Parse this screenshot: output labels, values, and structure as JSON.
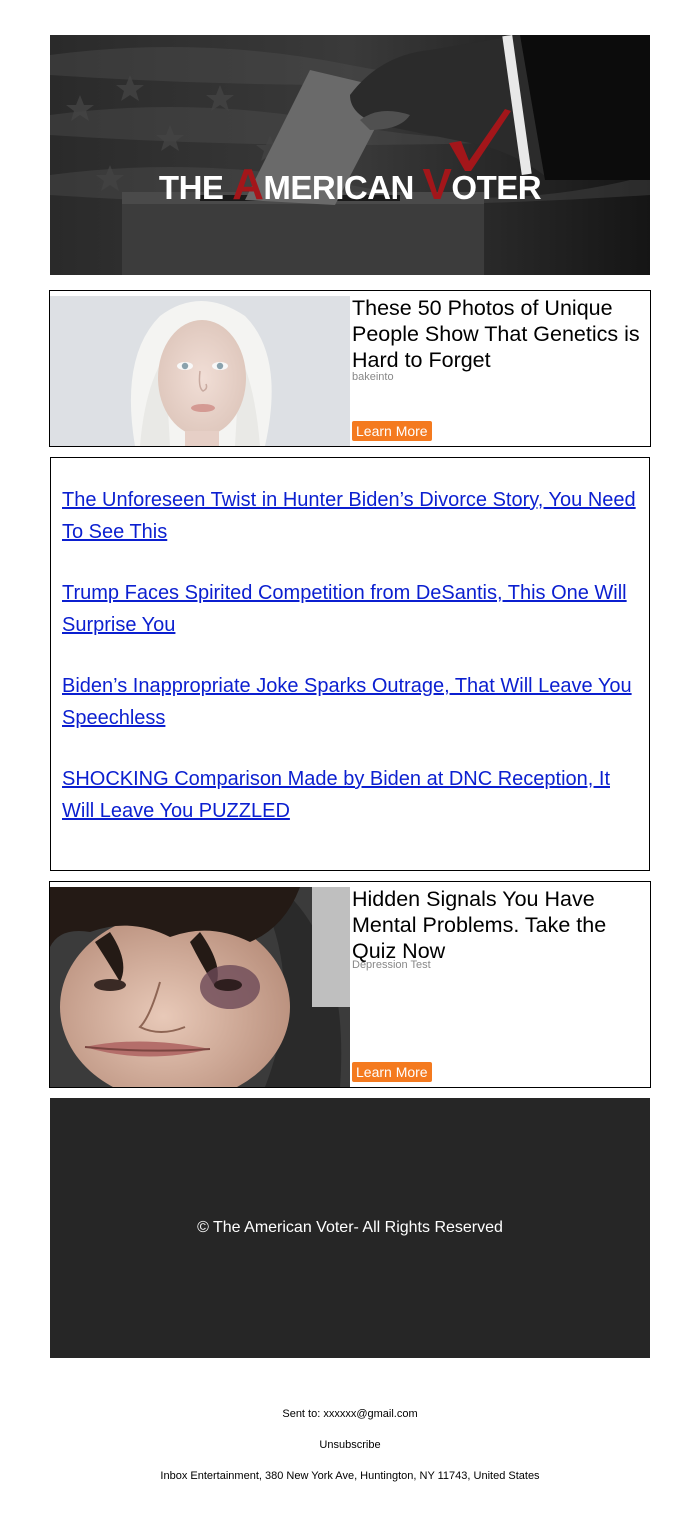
{
  "header": {
    "logo_part1": "THE ",
    "logo_cap_a": "A",
    "logo_part2": "MERICAN ",
    "logo_cap_v": "V",
    "logo_part3": "OTER"
  },
  "ads": [
    {
      "title": "These 50 Photos of Unique People Show That Genetics is Hard to Forget",
      "source": "bakeinto",
      "button": "Learn More"
    },
    {
      "title": " Hidden Signals You Have Mental Problems. Take the Quiz Now",
      "source": "Depression Test",
      "button": "Learn More"
    }
  ],
  "links": [
    "The Unforeseen Twist in Hunter Biden’s Divorce Story, You Need To See This",
    "Trump Faces Spirited Competition from DeSantis, This One Will Surprise You",
    "Biden’s Inappropriate Joke Sparks Outrage, That Will Leave You Speechless",
    "SHOCKING Comparison Made by Biden at DNC Reception, It Will Leave You PUZZLED"
  ],
  "footer": {
    "copyright": "© The American Voter- All Rights Reserved",
    "sent_to": "Sent to: xxxxxx@gmail.com",
    "unsubscribe": "Unsubscribe",
    "address": "Inbox Entertainment, 380 New York Ave, Huntington, NY 11743, United States"
  },
  "colors": {
    "link": "#0b1fd0",
    "button": "#f47a1f",
    "logo_red": "#a3161a",
    "footer_bg": "#262626"
  },
  "icons": [
    "checkmark-logo-icon"
  ]
}
